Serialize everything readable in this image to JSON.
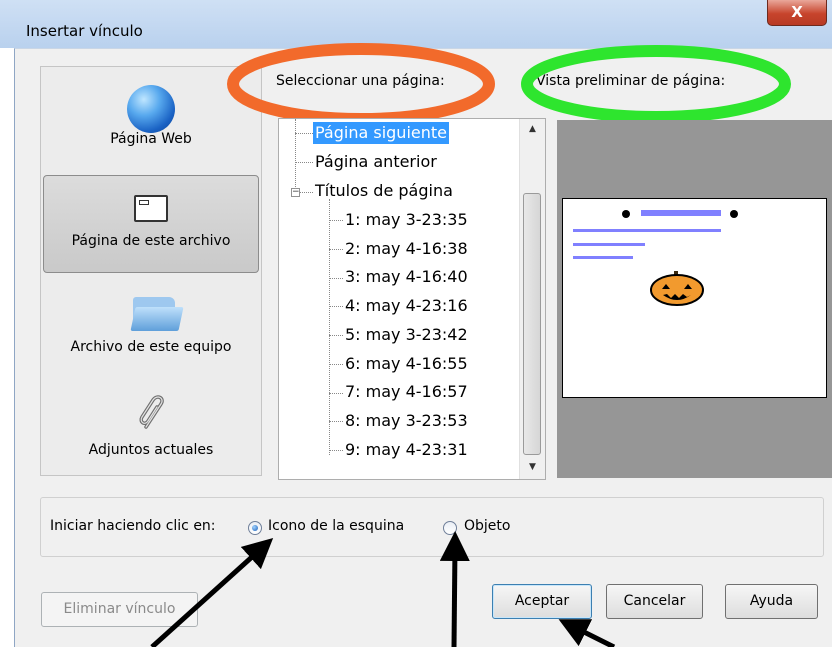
{
  "window": {
    "title": "Insertar vínculo",
    "close_glyph": "X"
  },
  "sidebar": {
    "items": [
      {
        "label": "Página Web",
        "icon": "globe-icon"
      },
      {
        "label": "Página de este archivo",
        "icon": "page-window-icon",
        "selected": true
      },
      {
        "label": "Archivo de este equipo",
        "icon": "folder-icon"
      },
      {
        "label": "Adjuntos actuales",
        "icon": "paperclip-icon"
      }
    ]
  },
  "select_page": {
    "label": "Seleccionar una página:",
    "items": [
      {
        "text": "Página siguiente",
        "selected": true
      },
      {
        "text": "Página anterior"
      },
      {
        "text": "Títulos de página",
        "expander": "−"
      },
      {
        "text": "1: may 3-23:35"
      },
      {
        "text": "2: may 4-16:38"
      },
      {
        "text": "3: may 4-16:40"
      },
      {
        "text": "4: may 4-23:16"
      },
      {
        "text": "5: may 3-23:42"
      },
      {
        "text": "6: may 4-16:55"
      },
      {
        "text": "7: may 4-16:57"
      },
      {
        "text": "8: may 3-23:53"
      },
      {
        "text": "9: may 4-23:31"
      }
    ]
  },
  "preview": {
    "label": "Vista preliminar de página:"
  },
  "iniciar": {
    "label": "Iniciar haciendo clic en:",
    "options": [
      {
        "label": "Icono de la esquina",
        "checked": true
      },
      {
        "label": "Objeto",
        "checked": false
      }
    ]
  },
  "buttons": {
    "remove_link": "Eliminar vínculo",
    "accept": "Aceptar",
    "cancel": "Cancelar",
    "help": "Ayuda"
  },
  "colors": {
    "annotation_orange": "#f26a2b",
    "annotation_green": "#2ee52e",
    "selection_blue": "#3399ff",
    "preview_line_blue": "#8080ff",
    "pumpkin_orange": "#f29a2e"
  }
}
